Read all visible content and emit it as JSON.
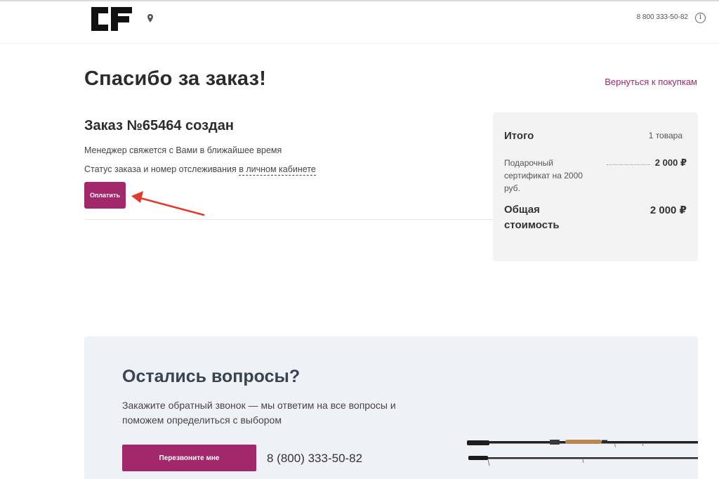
{
  "header": {
    "logo_text": "CF",
    "location_icon": "map-pin-icon",
    "phone": "8 800 333-50-82",
    "info_icon": "info-circle-icon",
    "info_glyph": "i"
  },
  "main": {
    "title": "Спасибо за заказ!",
    "back_link": "Вернуться к покупкам",
    "order_title": "Заказ №65464 создан",
    "manager_note": "Менеджер свяжется с Вами в ближайшее время",
    "status_prefix": "Статус заказа и номер отслеживания ",
    "status_link": "в личном кабинете",
    "pay_button": "Оплатить"
  },
  "summary": {
    "title": "Итого",
    "count": "1 товара",
    "item_name": "Подарочный сертификат на 2000 руб.",
    "item_price": "2 000 ₽",
    "total_label": "Общая стоимость",
    "total_value": "2 000 ₽"
  },
  "questions": {
    "title": "Остались вопросы?",
    "text": "Закажите обратный звонок — мы ответим на все вопросы и поможем определиться с выбором",
    "callback_button": "Перезвоните мне",
    "phone": "8 (800) 333-50-82"
  },
  "colors": {
    "accent": "#a3286b",
    "annotation_arrow": "#e03a2f",
    "summary_bg": "#f3f3f3",
    "questions_bg": "#eef2f7"
  }
}
